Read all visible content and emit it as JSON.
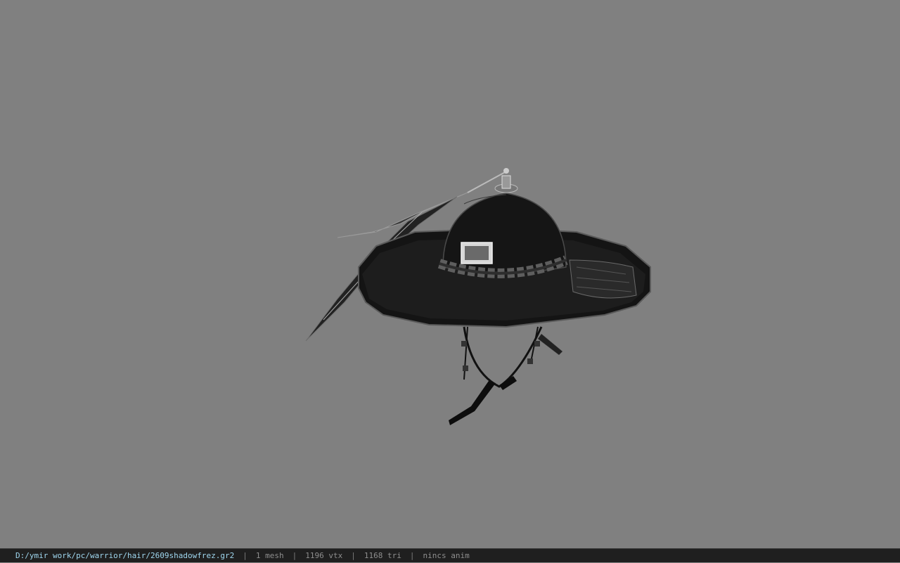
{
  "viewport": {
    "background_color": "#808080",
    "model_description": "hat-model"
  },
  "status_bar": {
    "file_path": "D:/ymir work/pc/warrior/hair/2609shadowfrez.gr2",
    "separator": "|",
    "mesh_count": "1 mesh",
    "vertex_count": "1196 vtx",
    "triangle_count": "1168 tri",
    "animation": "nincs anim",
    "path_color": "#9fd6ee"
  }
}
